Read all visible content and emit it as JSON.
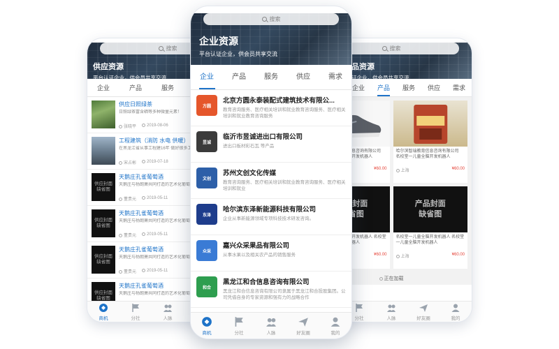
{
  "left": {
    "search_placeholder": "搜索",
    "title": "供应资源",
    "subtitle": "平台认证企业，供会员共享交流",
    "tabs": [
      "企业",
      "产品",
      "服务",
      "供应",
      "需"
    ],
    "active_tab": 3,
    "items": [
      {
        "title": "供应日照绿茶",
        "desc": "日照绿茶富含硒等多种微量元素！",
        "author": "张晓平",
        "date": "2019-08-06",
        "thumb": ""
      },
      {
        "title": "工程建筑（消防 水电 供暖）",
        "desc": "在黑龙江省从事工程建16年 做好很多工程，公司主要做：消防",
        "author": "宋占彬",
        "date": "2019-07-18",
        "thumb": ""
      },
      {
        "title": "天鹅庄孔雀葡萄酒",
        "desc": "天鹅庄与杨朗萧共同打造的艺术化葡萄酒品牌",
        "author": "董贵元",
        "date": "2019-05-11",
        "thumb": "供应封面\n缺省图"
      },
      {
        "title": "天鹅庄孔雀葡萄酒",
        "desc": "天鹅庄与杨朗萧共同打造的艺术化葡萄酒品牌",
        "author": "董贵元",
        "date": "2019-05-11",
        "thumb": "供应封面\n缺省图"
      },
      {
        "title": "天鹅庄孔雀葡萄酒",
        "desc": "天鹅庄与杨朗萧共同打造的艺术化葡萄酒品牌",
        "author": "董贵元",
        "date": "2019-05-11",
        "thumb": "供应封面\n缺省图"
      },
      {
        "title": "天鹅庄孔雀葡萄酒",
        "desc": "天鹅庄与杨朗萧共同打造的艺术化葡萄酒品牌",
        "author": "董贵元",
        "date": "2019-05-11",
        "thumb": "供应封面\n缺省图"
      }
    ],
    "nav": [
      "商机",
      "分社",
      "人脉",
      "好友圈",
      "我的"
    ]
  },
  "center": {
    "search_placeholder": "搜索",
    "title": "企业资源",
    "subtitle": "平台认证企业，供会员共享交流",
    "tabs": [
      "企业",
      "产品",
      "服务",
      "供应",
      "需求"
    ],
    "active_tab": 0,
    "items": [
      {
        "title": "北京方圆永泰装配式建筑技术有限公...",
        "desc": "教育咨询服务、医疗相关培训和就业教育咨询服务、医疗相关培训和就业教育咨询服务",
        "logo_color": "#e5562b",
        "logo_text": "方圆"
      },
      {
        "title": "临沂市昱诚进出口有限公司",
        "desc": "进出口板材彩石瓦 等产品",
        "logo_color": "#3b3b3b",
        "logo_text": "昱诚"
      },
      {
        "title": "苏州文创文化传媒",
        "desc": "教育咨询服务、医疗相关培训和就业教育咨询服务、医疗相关培训和就业",
        "logo_color": "#2d5fa8",
        "logo_text": "文创"
      },
      {
        "title": "哈尔滨东泽新能源科技有限公司",
        "desc": "企业从事新能源领域专项科技技术研发咨询。",
        "logo_color": "#1e3d8c",
        "logo_text": "东泽"
      },
      {
        "title": "嘉兴众采果品有限公司",
        "desc": "从事水果以及相关农产品的销售服务",
        "logo_color": "#3a7bd5",
        "logo_text": "众采"
      },
      {
        "title": "黑龙江和合信息咨询有限公司",
        "desc": "黑龙江和合信息咨询有限公司隶属于黑龙江和合投股集团。公司凭借自身的专家资源和强有力的战略合作",
        "logo_color": "#2e9e4f",
        "logo_text": "和合"
      },
      {
        "title": "哈尔滨智瑞教育信息咨询有限公司",
        "desc": "教育咨询服务、医疗相关培训和就业教育咨询服务",
        "logo_color": "#d8342a",
        "logo_text": "智瑞"
      }
    ],
    "nav": [
      "商机",
      "分社",
      "人脉",
      "好友圈",
      "我的"
    ]
  },
  "right": {
    "search_placeholder": "搜索",
    "title": "品资源",
    "subtitle": "证企业，供会员共享交流",
    "tabs": [
      "企业",
      "产品",
      "服务",
      "供应",
      "需求"
    ],
    "active_tab": 1,
    "items": [
      {
        "desc": "哈尔滨智瑞教育信息咨询有限公司",
        "sub": "名校堂一儿童全脑开发机器人",
        "loc": "上海",
        "price": "¥60.00",
        "kind": "shoe",
        "cover": ""
      },
      {
        "desc": "哈尔滨智瑞教育信息咨询有限公司",
        "sub": "名校堂一儿童全脑开发机器人",
        "loc": "上海",
        "price": "¥60.00",
        "kind": "food",
        "cover": ""
      },
      {
        "desc": "名校堂一儿童全脑开发机器人 名校堂一儿童全脑开发机器人",
        "sub": "",
        "loc": "上海",
        "price": "¥60.00",
        "kind": "dark",
        "cover": "产品封面\n缺省图"
      },
      {
        "desc": "名校堂一儿童全脑开发机器人 名校堂一儿童全脑开发机器人",
        "sub": "",
        "loc": "上海",
        "price": "¥60.00",
        "kind": "dark",
        "cover": "产品封面\n缺省图"
      }
    ],
    "loading": "正在加载",
    "nav": [
      "商机",
      "分社",
      "人脉",
      "好友圈",
      "我的"
    ]
  },
  "colors": {
    "accent": "#1e73c8",
    "price": "#e5463b"
  }
}
